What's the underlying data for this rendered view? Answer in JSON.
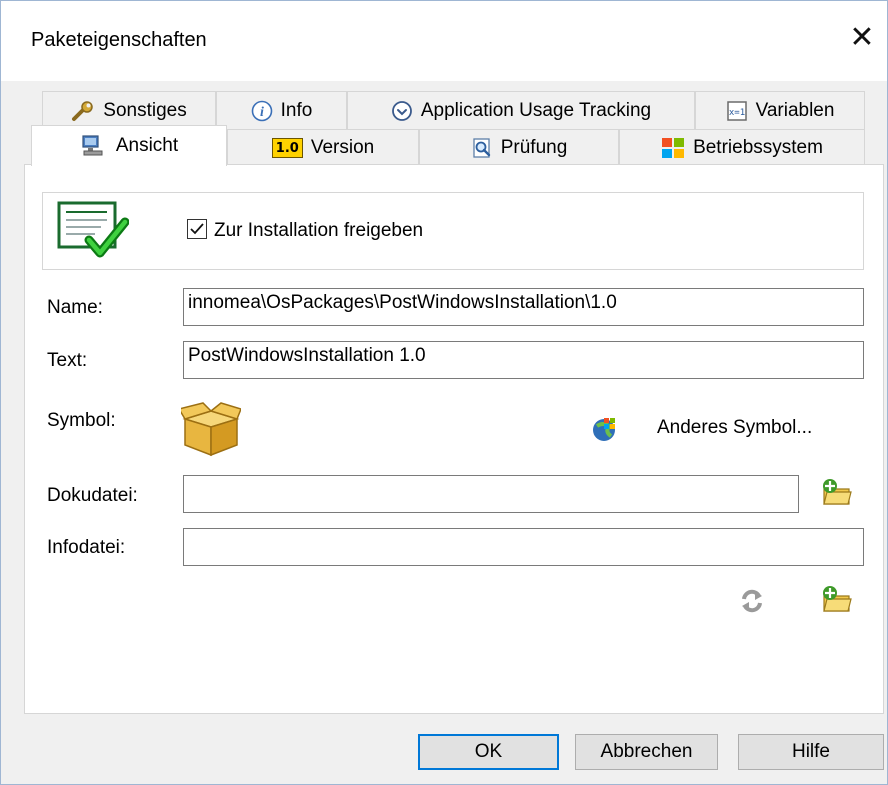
{
  "window": {
    "title": "Paketeigenschaften",
    "close_symbol": "✕"
  },
  "tabs_row1": [
    {
      "label": "Sonstiges",
      "icon": "wrench-icon"
    },
    {
      "label": "Info",
      "icon": "info-icon"
    },
    {
      "label": "Application Usage Tracking",
      "icon": "clock-icon"
    },
    {
      "label": "Variablen",
      "icon": "variables-icon"
    }
  ],
  "tabs_row2": [
    {
      "label": "Ansicht",
      "icon": "computer-icon",
      "active": true
    },
    {
      "label": "Version",
      "icon": "version-icon",
      "badge": "1.0"
    },
    {
      "label": "Prüfung",
      "icon": "magnifier-icon"
    },
    {
      "label": "Betriebssystem",
      "icon": "windows-logo-icon"
    }
  ],
  "release": {
    "checkbox_label": "Zur Installation freigeben",
    "checked": true
  },
  "form": {
    "name_label": "Name:",
    "name_value": "innomea\\OsPackages\\PostWindowsInstallation\\1.0",
    "text_label": "Text:",
    "text_value": "PostWindowsInstallation 1.0",
    "symbol_label": "Symbol:",
    "other_symbol_label": "Anderes Symbol...",
    "doc_label": "Dokudatei:",
    "doc_value": "",
    "info_label": "Infodatei:",
    "info_value": ""
  },
  "buttons": {
    "ok": "OK",
    "cancel": "Abbrechen",
    "help": "Hilfe"
  },
  "colors": {
    "accent": "#0078d7",
    "window_border": "#9fb6d3",
    "folder_green": "#3f9a2a",
    "folder_yellow": "#f2c94c"
  }
}
